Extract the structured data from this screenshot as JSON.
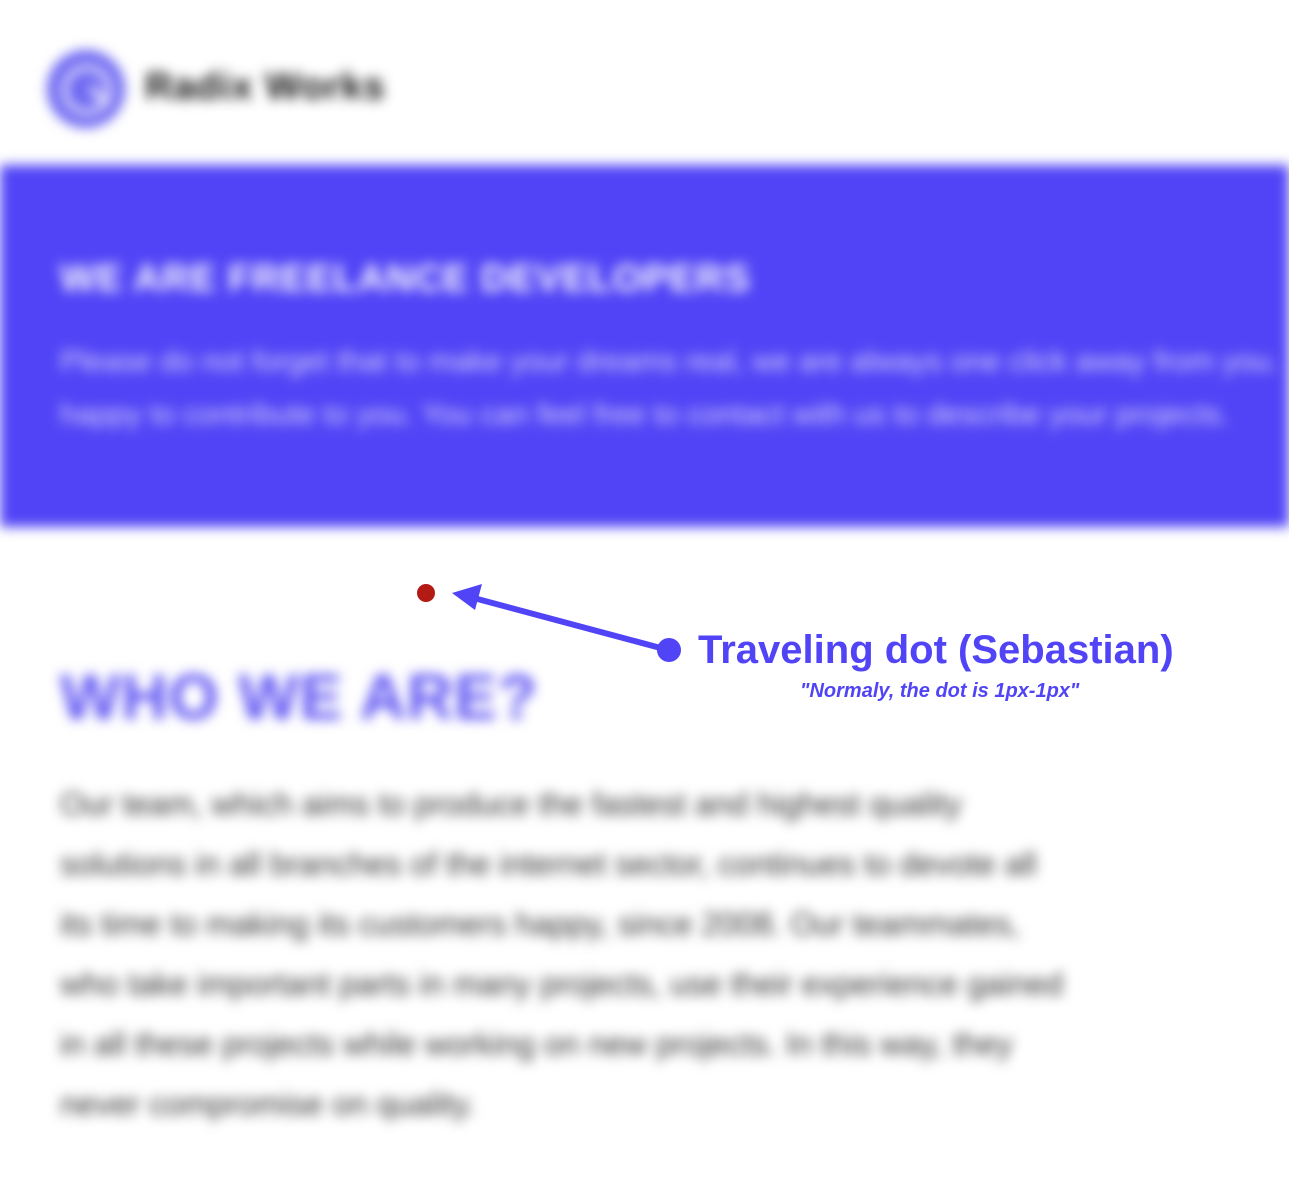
{
  "brand": {
    "name": "Radix Works",
    "logo_icon": "radix-logo-icon",
    "accent_color": "#5144f6"
  },
  "hero": {
    "title": "WE ARE FREELANCE DEVELOPERS",
    "lines": [
      "Please do not forget that to make your dreams real, we are always one click away from you.",
      "happy to contribute to you. You can feel free to contact with us to describe your projects."
    ],
    "background_color": "#5144f6"
  },
  "about": {
    "title": "WHO WE ARE?",
    "lines": [
      "Our team, which aims to produce the fastest and highest quality",
      "solutions in all branches of the internet sector, continues to devote all",
      "its time to making its customers happy, since 2008. Our teammates,",
      "who take important parts in many projects, use their experience gained",
      "in all these projects while working on new projects. In this way, they",
      "never compromise on quality."
    ]
  },
  "annotation": {
    "title": "Traveling dot (Sebastian)",
    "note": "\"Normaly, the dot is 1px-1px\"",
    "dot_color": "#b31a14",
    "arrow_icon": "arrow-left-icon"
  }
}
